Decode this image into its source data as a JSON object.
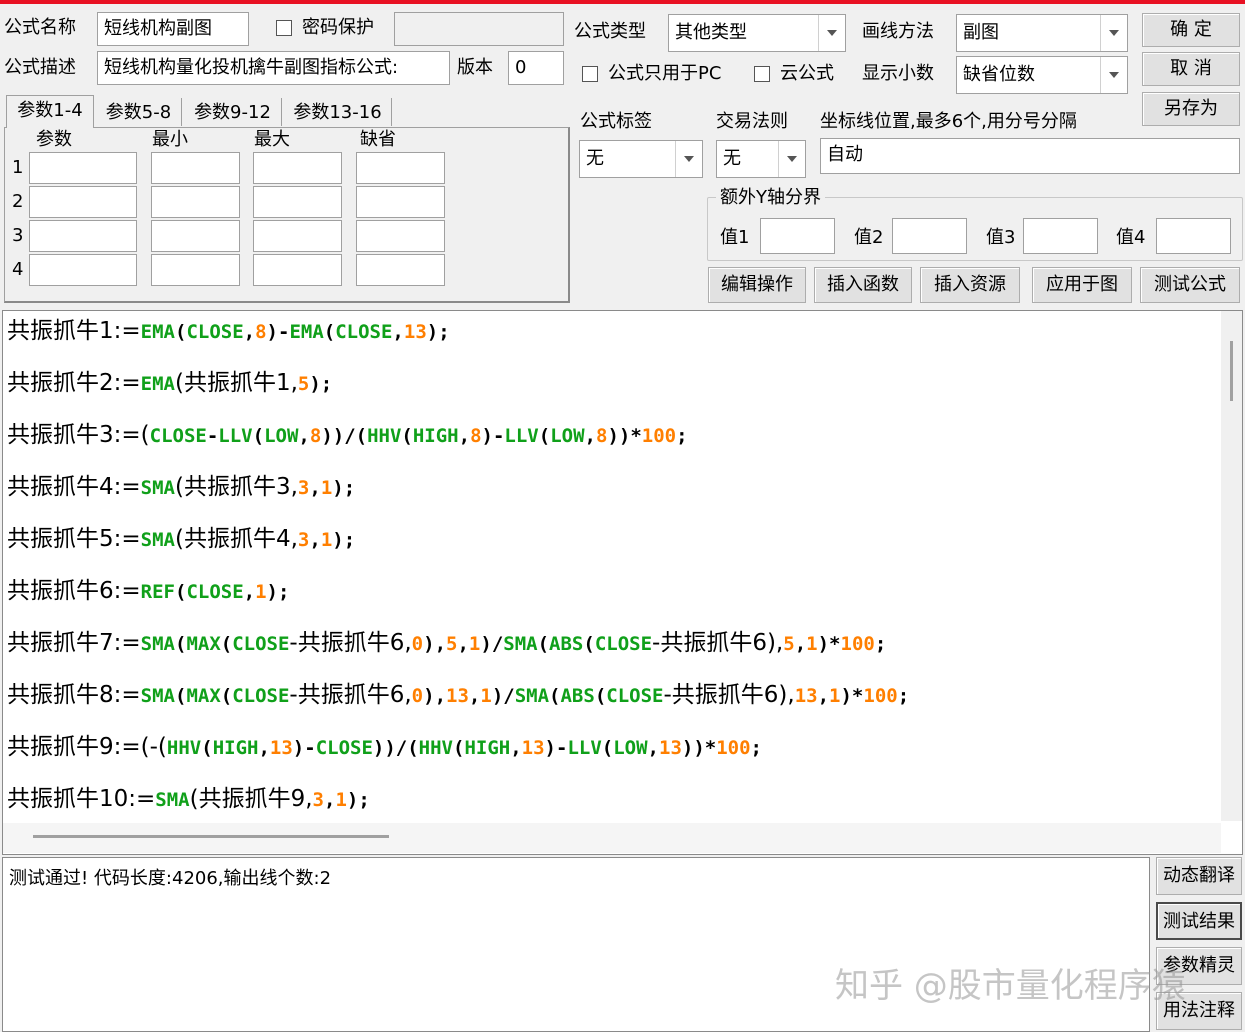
{
  "top": {
    "name_label": "公式名称",
    "name_value": "短线机构副图",
    "pwd_label": "密码保护",
    "desc_label": "公式描述",
    "desc_value": "短线机构量化投机擒牛副图指标公式:",
    "version_label": "版本",
    "version_value": "0",
    "type_label": "公式类型",
    "type_value": "其他类型",
    "draw_label": "画线方法",
    "draw_value": "副图",
    "pc_only_label": "公式只用于PC",
    "cloud_label": "云公式",
    "decimals_label": "显示小数",
    "decimals_value": "缺省位数",
    "ok": "确  定",
    "cancel": "取  消",
    "save_as": "另存为"
  },
  "tabs": [
    "参数1-4",
    "参数5-8",
    "参数9-12",
    "参数13-16"
  ],
  "params": {
    "headers": [
      "参数",
      "最小",
      "最大",
      "缺省"
    ],
    "rows": [
      "1",
      "2",
      "3",
      "4"
    ]
  },
  "right_mid": {
    "tag_label": "公式标签",
    "tag_value": "无",
    "rule_label": "交易法则",
    "rule_value": "无",
    "axis_label": "坐标线位置,最多6个,用分号分隔",
    "axis_value": "自动",
    "y_group": "额外Y轴分界",
    "v1": "值1",
    "v2": "值2",
    "v3": "值3",
    "v4": "值4"
  },
  "actions": [
    "编辑操作",
    "插入函数",
    "插入资源",
    "应用于图",
    "测试公式"
  ],
  "code_lines": [
    [
      [
        "共振抓牛1:=",
        "d"
      ],
      [
        "EMA",
        "f"
      ],
      [
        "(",
        "d"
      ],
      [
        "CLOSE",
        "f"
      ],
      [
        ",",
        "d"
      ],
      [
        "8",
        "n"
      ],
      [
        ")-",
        "d"
      ],
      [
        "EMA",
        "f"
      ],
      [
        "(",
        "d"
      ],
      [
        "CLOSE",
        "f"
      ],
      [
        ",",
        "d"
      ],
      [
        "13",
        "n"
      ],
      [
        ");",
        "d"
      ]
    ],
    [
      [
        "共振抓牛2:=",
        "d"
      ],
      [
        "EMA",
        "f"
      ],
      [
        "(共振抓牛1,",
        "d"
      ],
      [
        "5",
        "n"
      ],
      [
        ");",
        "d"
      ]
    ],
    [
      [
        "共振抓牛3:=(",
        "d"
      ],
      [
        "CLOSE",
        "f"
      ],
      [
        "-",
        "d"
      ],
      [
        "LLV",
        "f"
      ],
      [
        "(",
        "d"
      ],
      [
        "LOW",
        "f"
      ],
      [
        ",",
        "d"
      ],
      [
        "8",
        "n"
      ],
      [
        "))/(",
        "d"
      ],
      [
        "HHV",
        "f"
      ],
      [
        "(",
        "d"
      ],
      [
        "HIGH",
        "f"
      ],
      [
        ",",
        "d"
      ],
      [
        "8",
        "n"
      ],
      [
        ")-",
        "d"
      ],
      [
        "LLV",
        "f"
      ],
      [
        "(",
        "d"
      ],
      [
        "LOW",
        "f"
      ],
      [
        ",",
        "d"
      ],
      [
        "8",
        "n"
      ],
      [
        "))*",
        "d"
      ],
      [
        "100",
        "n"
      ],
      [
        ";",
        "d"
      ]
    ],
    [
      [
        "共振抓牛4:=",
        "d"
      ],
      [
        "SMA",
        "f"
      ],
      [
        "(共振抓牛3,",
        "d"
      ],
      [
        "3",
        "n"
      ],
      [
        ",",
        "d"
      ],
      [
        "1",
        "n"
      ],
      [
        ");",
        "d"
      ]
    ],
    [
      [
        "共振抓牛5:=",
        "d"
      ],
      [
        "SMA",
        "f"
      ],
      [
        "(共振抓牛4,",
        "d"
      ],
      [
        "3",
        "n"
      ],
      [
        ",",
        "d"
      ],
      [
        "1",
        "n"
      ],
      [
        ");",
        "d"
      ]
    ],
    [
      [
        "共振抓牛6:=",
        "d"
      ],
      [
        "REF",
        "f"
      ],
      [
        "(",
        "d"
      ],
      [
        "CLOSE",
        "f"
      ],
      [
        ",",
        "d"
      ],
      [
        "1",
        "n"
      ],
      [
        ");",
        "d"
      ]
    ],
    [
      [
        "共振抓牛7:=",
        "d"
      ],
      [
        "SMA",
        "f"
      ],
      [
        "(",
        "d"
      ],
      [
        "MAX",
        "f"
      ],
      [
        "(",
        "d"
      ],
      [
        "CLOSE",
        "f"
      ],
      [
        "-共振抓牛6,",
        "d"
      ],
      [
        "0",
        "n"
      ],
      [
        "),",
        "d"
      ],
      [
        "5",
        "n"
      ],
      [
        ",",
        "d"
      ],
      [
        "1",
        "n"
      ],
      [
        ")/",
        "d"
      ],
      [
        "SMA",
        "f"
      ],
      [
        "(",
        "d"
      ],
      [
        "ABS",
        "f"
      ],
      [
        "(",
        "d"
      ],
      [
        "CLOSE",
        "f"
      ],
      [
        "-共振抓牛6),",
        "d"
      ],
      [
        "5",
        "n"
      ],
      [
        ",",
        "d"
      ],
      [
        "1",
        "n"
      ],
      [
        ")*",
        "d"
      ],
      [
        "100",
        "n"
      ],
      [
        ";",
        "d"
      ]
    ],
    [
      [
        "共振抓牛8:=",
        "d"
      ],
      [
        "SMA",
        "f"
      ],
      [
        "(",
        "d"
      ],
      [
        "MAX",
        "f"
      ],
      [
        "(",
        "d"
      ],
      [
        "CLOSE",
        "f"
      ],
      [
        "-共振抓牛6,",
        "d"
      ],
      [
        "0",
        "n"
      ],
      [
        "),",
        "d"
      ],
      [
        "13",
        "n"
      ],
      [
        ",",
        "d"
      ],
      [
        "1",
        "n"
      ],
      [
        ")/",
        "d"
      ],
      [
        "SMA",
        "f"
      ],
      [
        "(",
        "d"
      ],
      [
        "ABS",
        "f"
      ],
      [
        "(",
        "d"
      ],
      [
        "CLOSE",
        "f"
      ],
      [
        "-共振抓牛6),",
        "d"
      ],
      [
        "13",
        "n"
      ],
      [
        ",",
        "d"
      ],
      [
        "1",
        "n"
      ],
      [
        ")*",
        "d"
      ],
      [
        "100",
        "n"
      ],
      [
        ";",
        "d"
      ]
    ],
    [
      [
        "共振抓牛9:=(-(",
        "d"
      ],
      [
        "HHV",
        "f"
      ],
      [
        "(",
        "d"
      ],
      [
        "HIGH",
        "f"
      ],
      [
        ",",
        "d"
      ],
      [
        "13",
        "n"
      ],
      [
        ")-",
        "d"
      ],
      [
        "CLOSE",
        "f"
      ],
      [
        "))/(",
        "d"
      ],
      [
        "HHV",
        "f"
      ],
      [
        "(",
        "d"
      ],
      [
        "HIGH",
        "f"
      ],
      [
        ",",
        "d"
      ],
      [
        "13",
        "n"
      ],
      [
        ")-",
        "d"
      ],
      [
        "LLV",
        "f"
      ],
      [
        "(",
        "d"
      ],
      [
        "LOW",
        "f"
      ],
      [
        ",",
        "d"
      ],
      [
        "13",
        "n"
      ],
      [
        "))*",
        "d"
      ],
      [
        "100",
        "n"
      ],
      [
        ";",
        "d"
      ]
    ],
    [
      [
        "共振抓牛10:=",
        "d"
      ],
      [
        "SMA",
        "f"
      ],
      [
        "(共振抓牛9,",
        "d"
      ],
      [
        "3",
        "n"
      ],
      [
        ",",
        "d"
      ],
      [
        "1",
        "n"
      ],
      [
        ");",
        "d"
      ]
    ]
  ],
  "colors": {
    "d": "#000000",
    "f": "#10a01a",
    "n": "#ff7f00"
  },
  "output_text": "测试通过! 代码长度:4206,输出线个数:2",
  "side_buttons": [
    "动态翻译",
    "测试结果",
    "参数精灵",
    "用法注释"
  ],
  "watermark": "知乎 @股市量化程序猿"
}
